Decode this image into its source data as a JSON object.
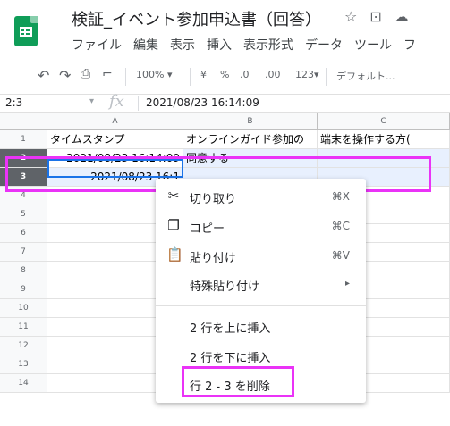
{
  "app": {
    "doc_title": "検証_イベント参加申込書（回答）",
    "title_icons": [
      "star-icon",
      "move-to-folder-icon",
      "cloud-status-icon"
    ],
    "menus": [
      "ファイル",
      "編集",
      "表示",
      "挿入",
      "表示形式",
      "データ",
      "ツール",
      "フ"
    ]
  },
  "toolbar": {
    "undo_icon": "undo-icon",
    "redo_icon": "redo-icon",
    "print_icon": "print-icon",
    "paint_format_icon": "paint-format-icon",
    "zoom": "100%",
    "currency": "¥",
    "percent": "%",
    "decrease_decimals": ".0",
    "increase_decimals": ".00",
    "more_formats": "123",
    "font": "デフォルト..."
  },
  "formula_bar": {
    "name_box": "2:3",
    "fx": "fx",
    "value": "2021/08/23 16:14:09"
  },
  "grid": {
    "columns": [
      "A",
      "B",
      "C"
    ],
    "rows": [
      "1",
      "2",
      "3",
      "4",
      "5",
      "6",
      "7",
      "8",
      "9",
      "10",
      "11",
      "12",
      "13",
      "14"
    ],
    "selected_rows": [
      "2",
      "3"
    ],
    "cells": {
      "a1": "タイムスタンプ",
      "b1": "オンラインガイド参加の",
      "c1": "端末を操作する方(",
      "a2": "2021/08/23 16:14:09",
      "b2": "同意する",
      "a3": "2021/08/23 16:1"
    }
  },
  "context_menu": {
    "cut": {
      "icon": "scissors-icon",
      "label": "切り取り",
      "shortcut": "⌘X"
    },
    "copy": {
      "icon": "copy-icon",
      "label": "コピー",
      "shortcut": "⌘C"
    },
    "paste": {
      "icon": "clipboard-icon",
      "label": "貼り付け",
      "shortcut": "⌘V"
    },
    "paste_special": {
      "label": "特殊貼り付け",
      "arrow": "▸"
    },
    "insert_above": "2 行を上に挿入",
    "insert_below": "2 行を下に挿入",
    "delete_rows": "行 2 - 3 を削除"
  },
  "colors": {
    "highlight": "#ea33f7",
    "selection": "#e8f0fe",
    "active_border": "#1a73e8",
    "sheets_green": "#0f9d58"
  }
}
